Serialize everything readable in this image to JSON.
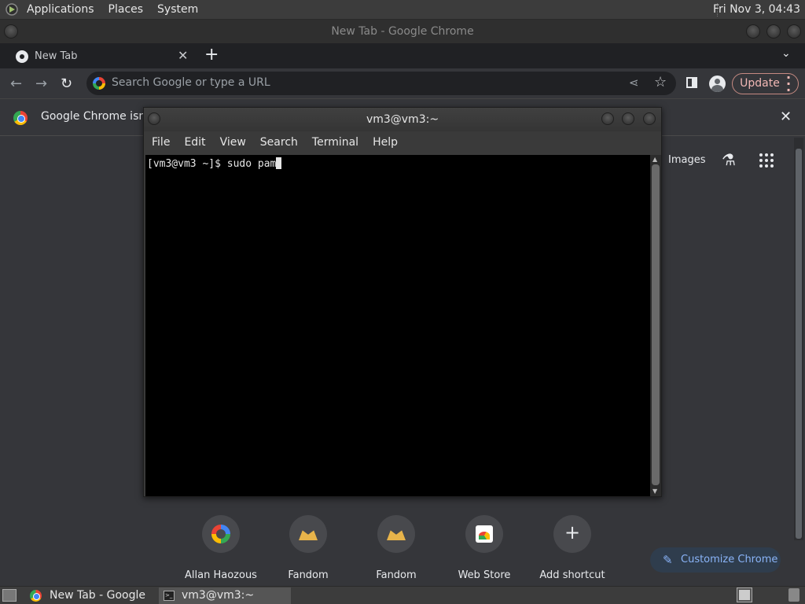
{
  "top_panel": {
    "menus": [
      "Applications",
      "Places",
      "System"
    ],
    "clock": "Fri Nov  3, 04:43"
  },
  "chrome": {
    "window_title": "New Tab - Google Chrome",
    "tab": {
      "title": "New Tab",
      "close": "✕"
    },
    "new_tab": "+",
    "tab_menu": "⌄",
    "omnibox": {
      "placeholder": "Search Google or type a URL"
    },
    "update_label": "Update",
    "infobar_text": "Google Chrome isn't",
    "infobar_close": "✕",
    "ntp": {
      "images_link": "Images",
      "shortcuts": [
        {
          "label": "Allan Haozous",
          "icon": "google-icon"
        },
        {
          "label": "Fandom",
          "icon": "fandom-icon"
        },
        {
          "label": "Fandom",
          "icon": "fandom-icon"
        },
        {
          "label": "Web Store",
          "icon": "web-store-icon"
        },
        {
          "label": "Add shortcut",
          "icon": "plus-icon"
        }
      ],
      "customize_label": "Customize Chrome"
    }
  },
  "terminal": {
    "title": "vm3@vm3:~",
    "menus": [
      "File",
      "Edit",
      "View",
      "Search",
      "Terminal",
      "Help"
    ],
    "prompt_line": "[vm3@vm3 ~]$ sudo pam"
  },
  "taskbar": {
    "tasks": [
      {
        "title": "New Tab - Google ..."
      },
      {
        "title": "vm3@vm3:~"
      }
    ]
  },
  "colors": {
    "accent_blue": "#8ab4f8",
    "update_red": "#f2b8b5",
    "chrome_dark": "#35363a"
  }
}
